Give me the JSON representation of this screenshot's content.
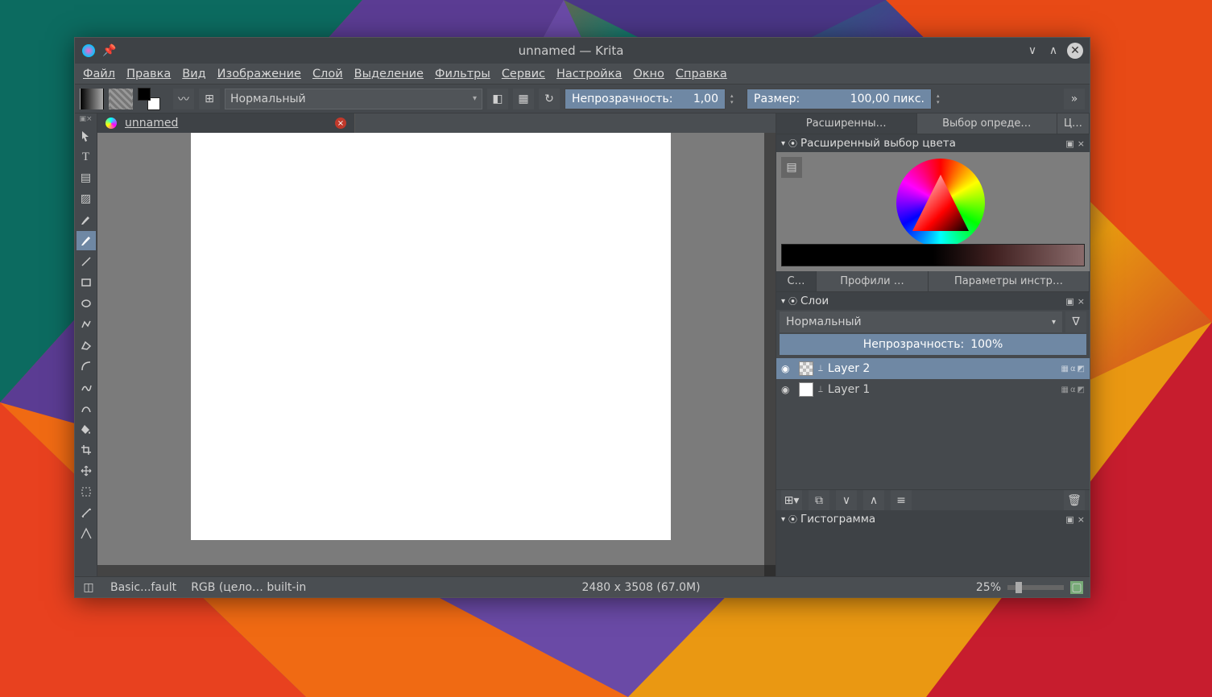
{
  "window": {
    "title": "unnamed  — Krita",
    "document_tab": "unnamed"
  },
  "menu": {
    "file": "Файл",
    "edit": "Правка",
    "view": "Вид",
    "image": "Изображение",
    "layer": "Слой",
    "select": "Выделение",
    "filters": "Фильтры",
    "tools": "Сервис",
    "settings": "Настройка",
    "window": "Окно",
    "help": "Справка"
  },
  "toolbar": {
    "blend_label": "Нормальный",
    "opacity_label": "Непрозрачность:",
    "opacity_value": "1,00",
    "size_label": "Размер:",
    "size_value": "100,00 пикс."
  },
  "tools": [
    "move",
    "arrow",
    "text",
    "gradient-edit",
    "pattern",
    "brush",
    "smart-brush",
    "ink",
    "line",
    "rect",
    "ellipse",
    "polyline",
    "polygon",
    "bezier",
    "freehand",
    "calligraphy",
    "fill",
    "crop",
    "transform",
    "zoom",
    "assistants",
    "multi"
  ],
  "right_tabs": [
    "Расширенны…",
    "Выбор опреде…",
    "Ц…"
  ],
  "color_panel_title": "Расширенный выбор цвета",
  "right_tabs2": [
    "С…",
    "Профили …",
    "Параметры инстр…"
  ],
  "layers": {
    "title": "Слои",
    "blend": "Нормальный",
    "opacity_label": "Непрозрачность:",
    "opacity_value": "100%",
    "rows": [
      {
        "name": "Layer 2",
        "selected": true,
        "checker": true
      },
      {
        "name": "Layer 1",
        "selected": false,
        "checker": false
      }
    ]
  },
  "histogram_title": "Гистограмма",
  "status": {
    "preset": "Basic...fault",
    "colorspace": "RGB (цело… built-in",
    "dimensions": "2480 x 3508 (67.0M)",
    "zoom": "25%"
  }
}
